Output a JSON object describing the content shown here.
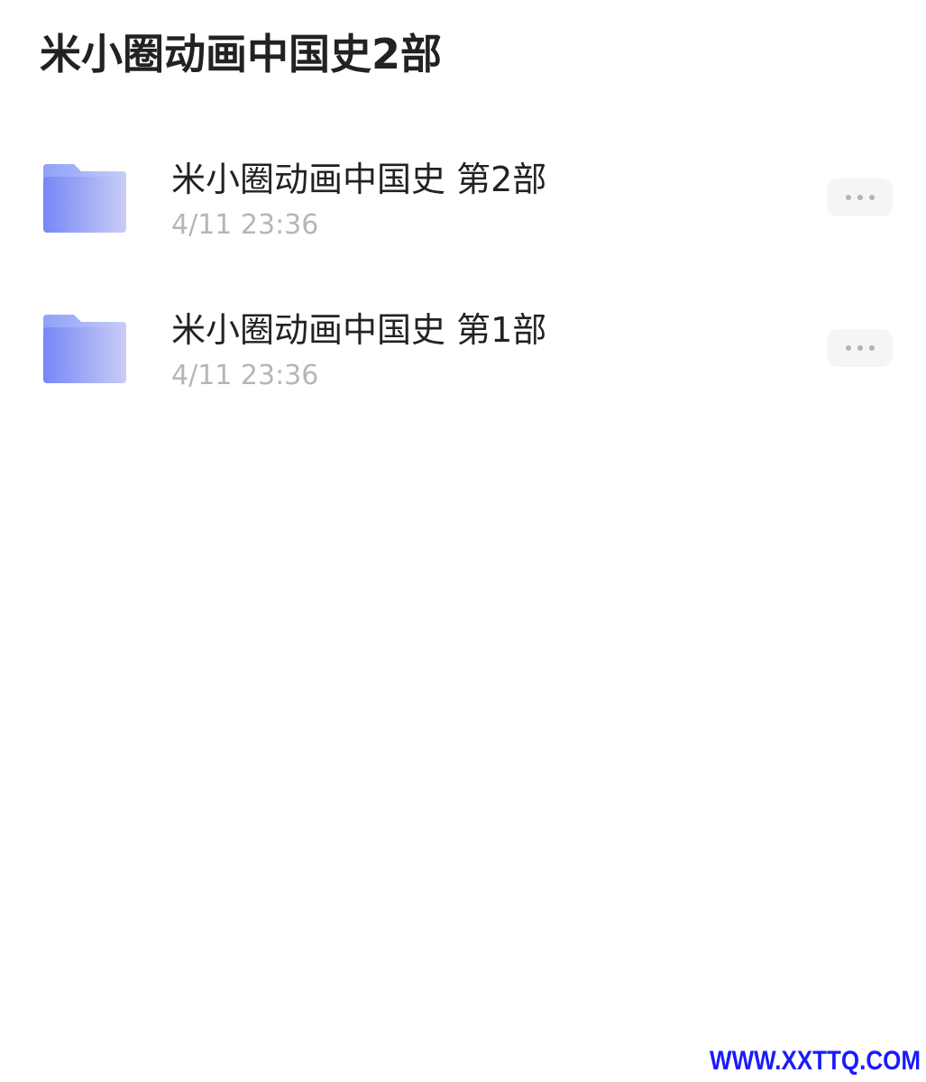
{
  "header": {
    "title": "米小圈动画中国史2部"
  },
  "folders": [
    {
      "name": "米小圈动画中国史 第2部",
      "time": "4/11 23:36",
      "icon": "folder-icon"
    },
    {
      "name": "米小圈动画中国史 第1部",
      "time": "4/11 23:36",
      "icon": "folder-icon"
    }
  ],
  "more_icon": "more-dots-icon",
  "watermark": "WWW.XXTTQ.COM",
  "colors": {
    "folder_gradient_start": "#7b8cf7",
    "folder_gradient_end": "#c7cbf6",
    "title_text": "#222222",
    "time_text": "#b6b6b6",
    "watermark": "#1a1aff"
  }
}
